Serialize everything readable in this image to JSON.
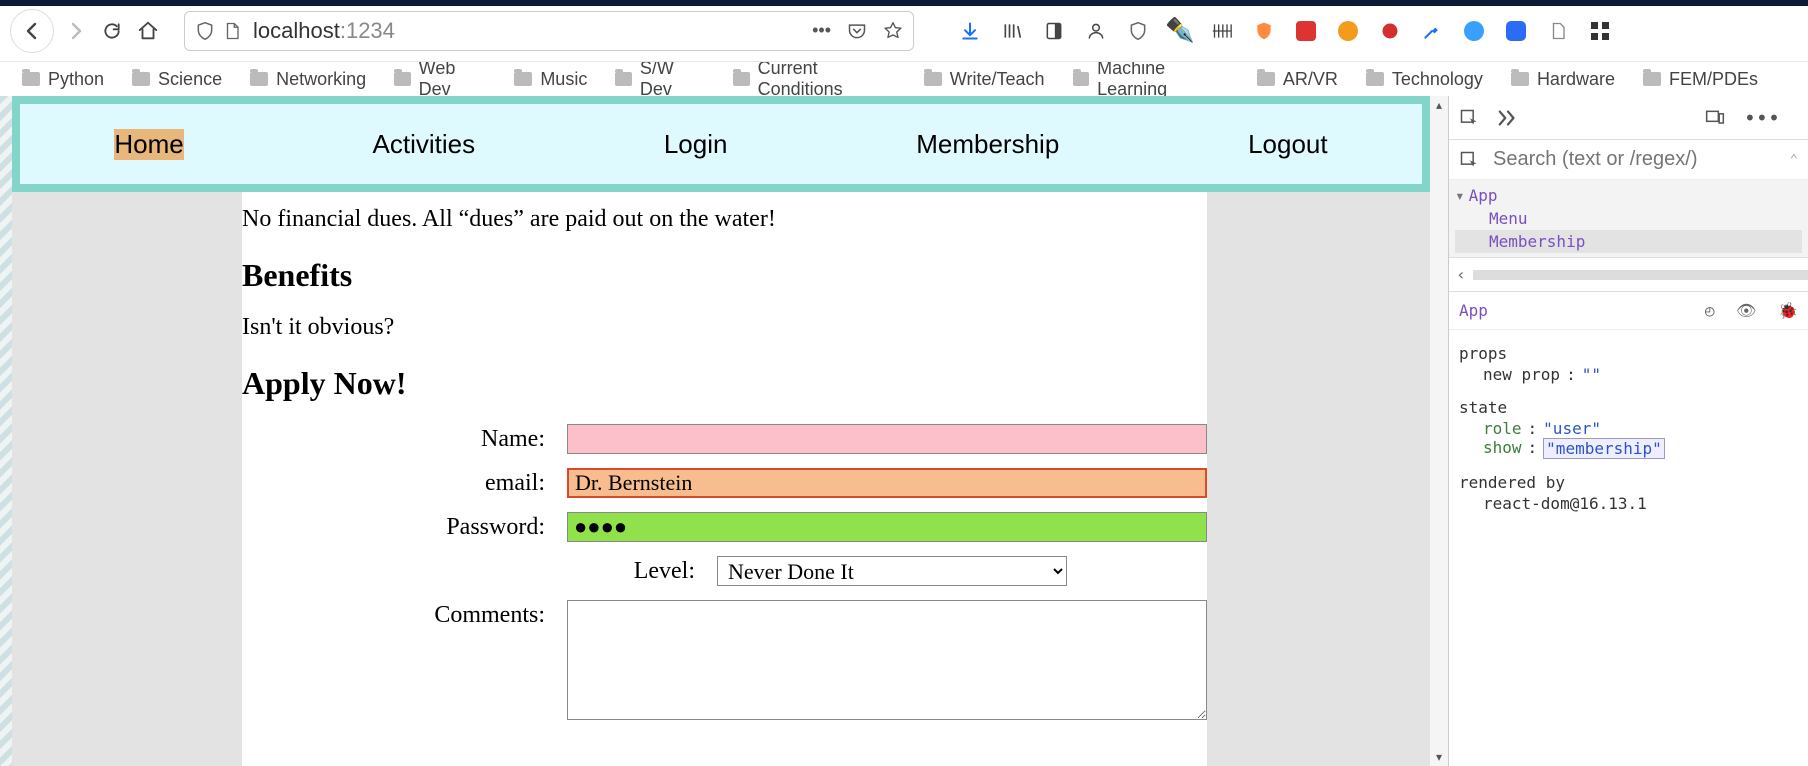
{
  "browser": {
    "url_host": "localhost",
    "url_port": ":1234"
  },
  "bookmarks": [
    "Python",
    "Science",
    "Networking",
    "Web Dev",
    "Music",
    "S/W Dev",
    "Current Conditions",
    "Write/Teach",
    "Machine Learning",
    "AR/VR",
    "Technology",
    "Hardware",
    "FEM/PDEs"
  ],
  "nav": {
    "items": [
      "Home",
      "Activities",
      "Login",
      "Membership",
      "Logout"
    ],
    "active": "Home"
  },
  "content": {
    "dues_line": "No financial dues. All “dues” are paid out on the water!",
    "benefits_heading": "Benefits",
    "benefits_text": "Isn't it obvious?",
    "apply_heading": "Apply Now!"
  },
  "form": {
    "name": {
      "label": "Name:",
      "value": ""
    },
    "email": {
      "label": "email:",
      "value": "Dr. Bernstein"
    },
    "password": {
      "label": "Password:",
      "value": "●●●●"
    },
    "level": {
      "label": "Level:",
      "value": "Never Done It"
    },
    "comments": {
      "label": "Comments:",
      "value": ""
    }
  },
  "devtools": {
    "search_placeholder": "Search (text or /regex/)",
    "tree": {
      "root": "App",
      "children": [
        "Menu",
        "Membership"
      ]
    },
    "crumb": "App",
    "props": {
      "heading": "props",
      "new_prop_label": "new prop",
      "new_prop_value": "\"\""
    },
    "state": {
      "heading": "state",
      "role": {
        "key": "role",
        "value": "\"user\""
      },
      "show": {
        "key": "show",
        "value": "\"membership\""
      }
    },
    "rendered_by": {
      "heading": "rendered by",
      "value": "react-dom@16.13.1"
    }
  }
}
